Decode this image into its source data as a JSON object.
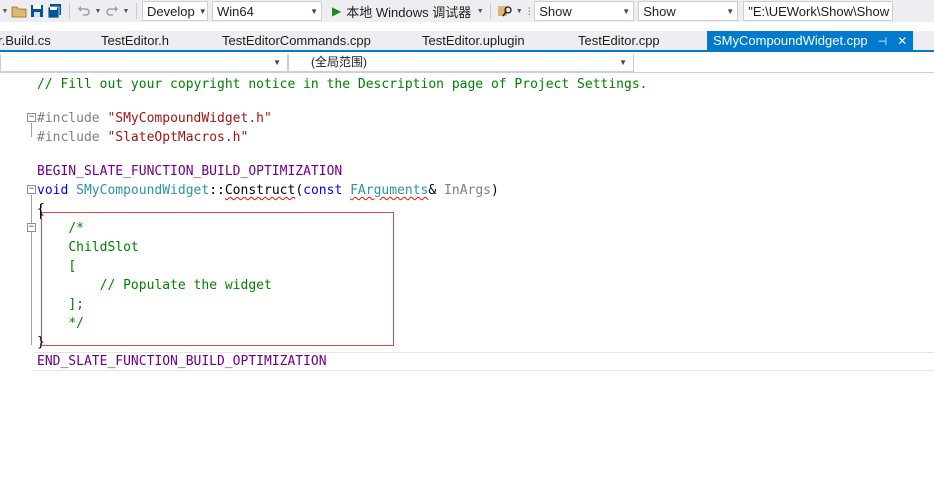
{
  "toolbar": {
    "config": "Develop",
    "platform": "Win64",
    "run_label": "本地 Windows 调试器",
    "show_1": "Show",
    "show_2": "Show",
    "path": "\"E:\\UEWork\\Show\\Show"
  },
  "tabs": [
    {
      "label": "r.Build.cs"
    },
    {
      "label": "TestEditor.h"
    },
    {
      "label": "TestEditorCommands.cpp"
    },
    {
      "label": "TestEditor.uplugin"
    },
    {
      "label": "TestEditor.cpp"
    },
    {
      "label": "SMyCompoundWidget.cpp",
      "active": true
    }
  ],
  "active_tab": {
    "label": "SMyCompoundWidget.cpp",
    "pin": "⊣",
    "close": "✕"
  },
  "navbar": {
    "scope": "(全局范围)"
  },
  "code": {
    "l1": "// Fill out your copyright notice in the Description page of Project Settings.",
    "inc1_kw": "#include",
    "inc1_str": "\"SMyCompoundWidget.h\"",
    "inc2_kw": "#include",
    "inc2_str": "\"SlateOptMacros.h\"",
    "begin": "BEGIN_SLATE_FUNCTION_BUILD_OPTIMIZATION",
    "void": "void",
    "cls": "SMyCompoundWidget",
    "scope": "::",
    "fn": "Construct",
    "open_paren": "(",
    "const": "const",
    "ftype": "FArguments",
    "amp": "&",
    "param": "InArgs",
    "close_paren": ")",
    "brace_open": "{",
    "c1": "/*",
    "c2": "ChildSlot",
    "c3": "[",
    "c4": "// Populate the widget",
    "c5": "];",
    "c6": "*/",
    "brace_close": "}",
    "end": "END_SLATE_FUNCTION_BUILD_OPTIMIZATION"
  },
  "colors": {
    "accent": "#007acc",
    "comment": "#008000",
    "keyword": "#0000ff",
    "type": "#2b91af",
    "macro": "#6f008a",
    "string": "#a31515",
    "highlight_box": "#e0484b"
  }
}
